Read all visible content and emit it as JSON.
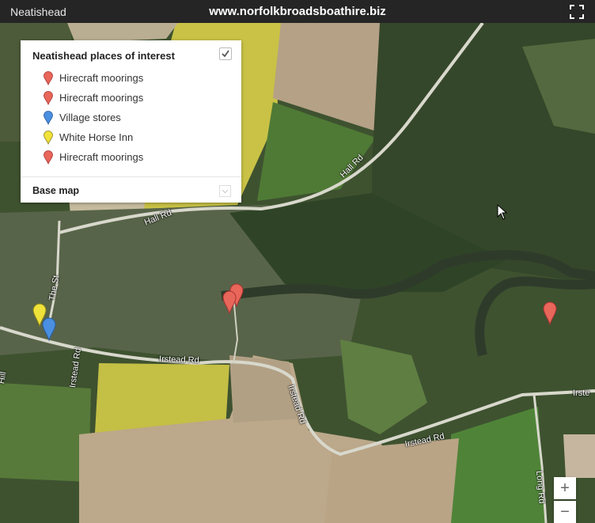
{
  "header": {
    "title": "Neatishead",
    "site": "www.norfolkbroadsboathire.biz"
  },
  "legend": {
    "title": "Neatishead places of interest",
    "items": [
      {
        "label": "Hirecraft moorings",
        "color": "#e8665a"
      },
      {
        "label": "Hirecraft moorings",
        "color": "#e8665a"
      },
      {
        "label": "Village stores",
        "color": "#4a8fe0"
      },
      {
        "label": "White Horse Inn",
        "color": "#f0e23a"
      },
      {
        "label": "Hirecraft moorings",
        "color": "#e8665a"
      }
    ],
    "base_map_label": "Base map"
  },
  "roads": {
    "hall_rd_1": "Hall Rd",
    "hall_rd_2": "Hall Rd",
    "the_st": "The St",
    "irstead_rd_1": "Irstead Rd",
    "irstead_rd_2": "Irstead Rd",
    "irstead_rd_3": "Irstead Rd",
    "irstead_rd_4": "Irstead Rd",
    "irstead_rd_5": "Irste",
    "long_rd": "Long Rd",
    "hill": "Hill"
  },
  "controls": {
    "zoom_in": "+",
    "zoom_out": "−"
  },
  "icons": {
    "fullscreen": "fullscreen-icon",
    "checkbox": "checkbox-icon",
    "marker": "map-pin-icon"
  }
}
